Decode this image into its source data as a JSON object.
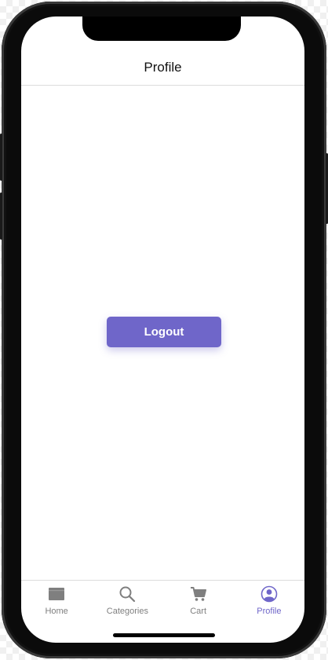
{
  "header": {
    "title": "Profile"
  },
  "main": {
    "logout_label": "Logout"
  },
  "tabbar": {
    "tabs": [
      {
        "label": "Home",
        "icon": "folder-icon",
        "active": false
      },
      {
        "label": "Categories",
        "icon": "search-icon",
        "active": false
      },
      {
        "label": "Cart",
        "icon": "cart-icon",
        "active": false
      },
      {
        "label": "Profile",
        "icon": "user-icon",
        "active": true
      }
    ]
  },
  "colors": {
    "accent": "#6f66c9",
    "inactive_icon": "#7f7f7f",
    "divider": "#dcdcdc",
    "frame": "#0b0b0b"
  }
}
